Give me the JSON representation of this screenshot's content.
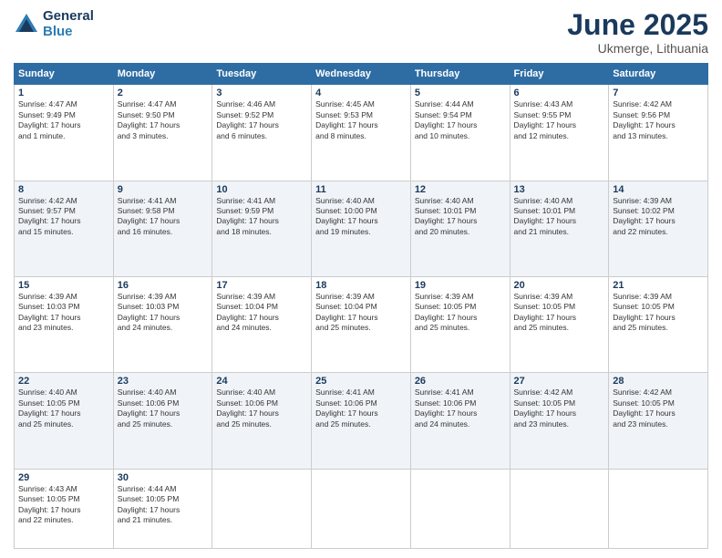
{
  "header": {
    "logo_general": "General",
    "logo_blue": "Blue",
    "month_title": "June 2025",
    "location": "Ukmerge, Lithuania"
  },
  "weekdays": [
    "Sunday",
    "Monday",
    "Tuesday",
    "Wednesday",
    "Thursday",
    "Friday",
    "Saturday"
  ],
  "weeks": [
    [
      {
        "day": "1",
        "info": "Sunrise: 4:47 AM\nSunset: 9:49 PM\nDaylight: 17 hours\nand 1 minute."
      },
      {
        "day": "2",
        "info": "Sunrise: 4:47 AM\nSunset: 9:50 PM\nDaylight: 17 hours\nand 3 minutes."
      },
      {
        "day": "3",
        "info": "Sunrise: 4:46 AM\nSunset: 9:52 PM\nDaylight: 17 hours\nand 6 minutes."
      },
      {
        "day": "4",
        "info": "Sunrise: 4:45 AM\nSunset: 9:53 PM\nDaylight: 17 hours\nand 8 minutes."
      },
      {
        "day": "5",
        "info": "Sunrise: 4:44 AM\nSunset: 9:54 PM\nDaylight: 17 hours\nand 10 minutes."
      },
      {
        "day": "6",
        "info": "Sunrise: 4:43 AM\nSunset: 9:55 PM\nDaylight: 17 hours\nand 12 minutes."
      },
      {
        "day": "7",
        "info": "Sunrise: 4:42 AM\nSunset: 9:56 PM\nDaylight: 17 hours\nand 13 minutes."
      }
    ],
    [
      {
        "day": "8",
        "info": "Sunrise: 4:42 AM\nSunset: 9:57 PM\nDaylight: 17 hours\nand 15 minutes."
      },
      {
        "day": "9",
        "info": "Sunrise: 4:41 AM\nSunset: 9:58 PM\nDaylight: 17 hours\nand 16 minutes."
      },
      {
        "day": "10",
        "info": "Sunrise: 4:41 AM\nSunset: 9:59 PM\nDaylight: 17 hours\nand 18 minutes."
      },
      {
        "day": "11",
        "info": "Sunrise: 4:40 AM\nSunset: 10:00 PM\nDaylight: 17 hours\nand 19 minutes."
      },
      {
        "day": "12",
        "info": "Sunrise: 4:40 AM\nSunset: 10:01 PM\nDaylight: 17 hours\nand 20 minutes."
      },
      {
        "day": "13",
        "info": "Sunrise: 4:40 AM\nSunset: 10:01 PM\nDaylight: 17 hours\nand 21 minutes."
      },
      {
        "day": "14",
        "info": "Sunrise: 4:39 AM\nSunset: 10:02 PM\nDaylight: 17 hours\nand 22 minutes."
      }
    ],
    [
      {
        "day": "15",
        "info": "Sunrise: 4:39 AM\nSunset: 10:03 PM\nDaylight: 17 hours\nand 23 minutes."
      },
      {
        "day": "16",
        "info": "Sunrise: 4:39 AM\nSunset: 10:03 PM\nDaylight: 17 hours\nand 24 minutes."
      },
      {
        "day": "17",
        "info": "Sunrise: 4:39 AM\nSunset: 10:04 PM\nDaylight: 17 hours\nand 24 minutes."
      },
      {
        "day": "18",
        "info": "Sunrise: 4:39 AM\nSunset: 10:04 PM\nDaylight: 17 hours\nand 25 minutes."
      },
      {
        "day": "19",
        "info": "Sunrise: 4:39 AM\nSunset: 10:05 PM\nDaylight: 17 hours\nand 25 minutes."
      },
      {
        "day": "20",
        "info": "Sunrise: 4:39 AM\nSunset: 10:05 PM\nDaylight: 17 hours\nand 25 minutes."
      },
      {
        "day": "21",
        "info": "Sunrise: 4:39 AM\nSunset: 10:05 PM\nDaylight: 17 hours\nand 25 minutes."
      }
    ],
    [
      {
        "day": "22",
        "info": "Sunrise: 4:40 AM\nSunset: 10:05 PM\nDaylight: 17 hours\nand 25 minutes."
      },
      {
        "day": "23",
        "info": "Sunrise: 4:40 AM\nSunset: 10:06 PM\nDaylight: 17 hours\nand 25 minutes."
      },
      {
        "day": "24",
        "info": "Sunrise: 4:40 AM\nSunset: 10:06 PM\nDaylight: 17 hours\nand 25 minutes."
      },
      {
        "day": "25",
        "info": "Sunrise: 4:41 AM\nSunset: 10:06 PM\nDaylight: 17 hours\nand 25 minutes."
      },
      {
        "day": "26",
        "info": "Sunrise: 4:41 AM\nSunset: 10:06 PM\nDaylight: 17 hours\nand 24 minutes."
      },
      {
        "day": "27",
        "info": "Sunrise: 4:42 AM\nSunset: 10:05 PM\nDaylight: 17 hours\nand 23 minutes."
      },
      {
        "day": "28",
        "info": "Sunrise: 4:42 AM\nSunset: 10:05 PM\nDaylight: 17 hours\nand 23 minutes."
      }
    ],
    [
      {
        "day": "29",
        "info": "Sunrise: 4:43 AM\nSunset: 10:05 PM\nDaylight: 17 hours\nand 22 minutes."
      },
      {
        "day": "30",
        "info": "Sunrise: 4:44 AM\nSunset: 10:05 PM\nDaylight: 17 hours\nand 21 minutes."
      },
      {
        "day": "",
        "info": ""
      },
      {
        "day": "",
        "info": ""
      },
      {
        "day": "",
        "info": ""
      },
      {
        "day": "",
        "info": ""
      },
      {
        "day": "",
        "info": ""
      }
    ]
  ]
}
